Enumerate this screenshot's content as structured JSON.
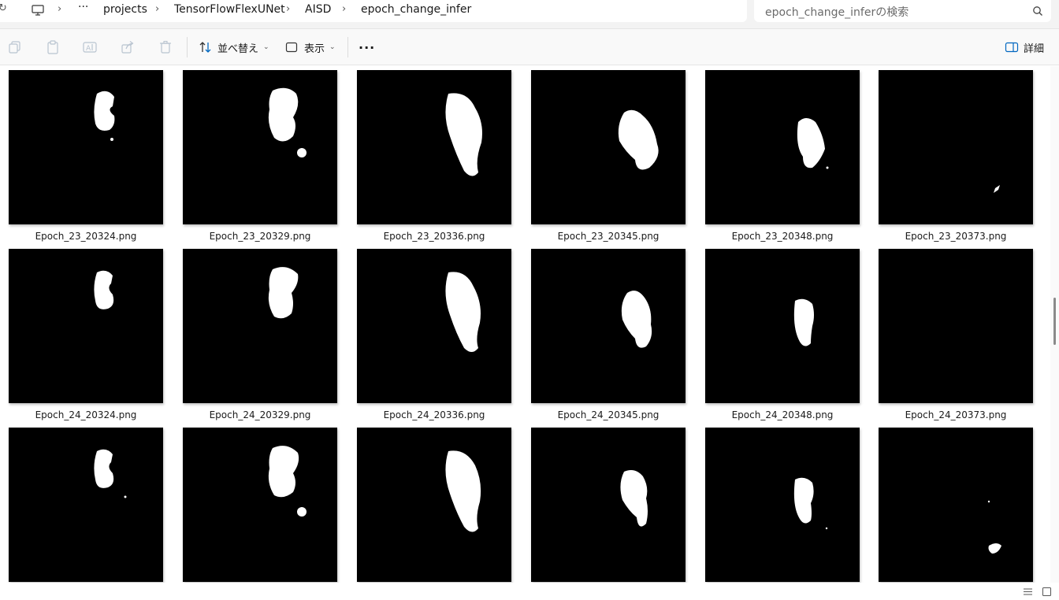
{
  "breadcrumb": {
    "ellipsis": "···",
    "items": [
      "projects",
      "TensorFlowFlexUNet",
      "AISD",
      "epoch_change_infer"
    ]
  },
  "search": {
    "placeholder": "epoch_change_inferの検索"
  },
  "toolbar": {
    "sort_label": "並べ替え",
    "view_label": "表示",
    "more_label": "···",
    "details_label": "詳細",
    "icons": [
      "copy-icon",
      "paste-icon",
      "rename-icon",
      "share-icon",
      "delete-icon"
    ]
  },
  "files": [
    {
      "name": "Epoch_23_20324.png"
    },
    {
      "name": "Epoch_23_20329.png"
    },
    {
      "name": "Epoch_23_20336.png"
    },
    {
      "name": "Epoch_23_20345.png"
    },
    {
      "name": "Epoch_23_20348.png"
    },
    {
      "name": "Epoch_23_20373.png"
    },
    {
      "name": "Epoch_24_20324.png"
    },
    {
      "name": "Epoch_24_20329.png"
    },
    {
      "name": "Epoch_24_20336.png"
    },
    {
      "name": "Epoch_24_20345.png"
    },
    {
      "name": "Epoch_24_20348.png"
    },
    {
      "name": "Epoch_24_20373.png"
    },
    {
      "name": ""
    },
    {
      "name": ""
    },
    {
      "name": ""
    },
    {
      "name": ""
    },
    {
      "name": ""
    },
    {
      "name": ""
    }
  ],
  "colors": {
    "accent": "#0067c0",
    "thumb_bg": "#000000",
    "mask": "#ffffff"
  }
}
